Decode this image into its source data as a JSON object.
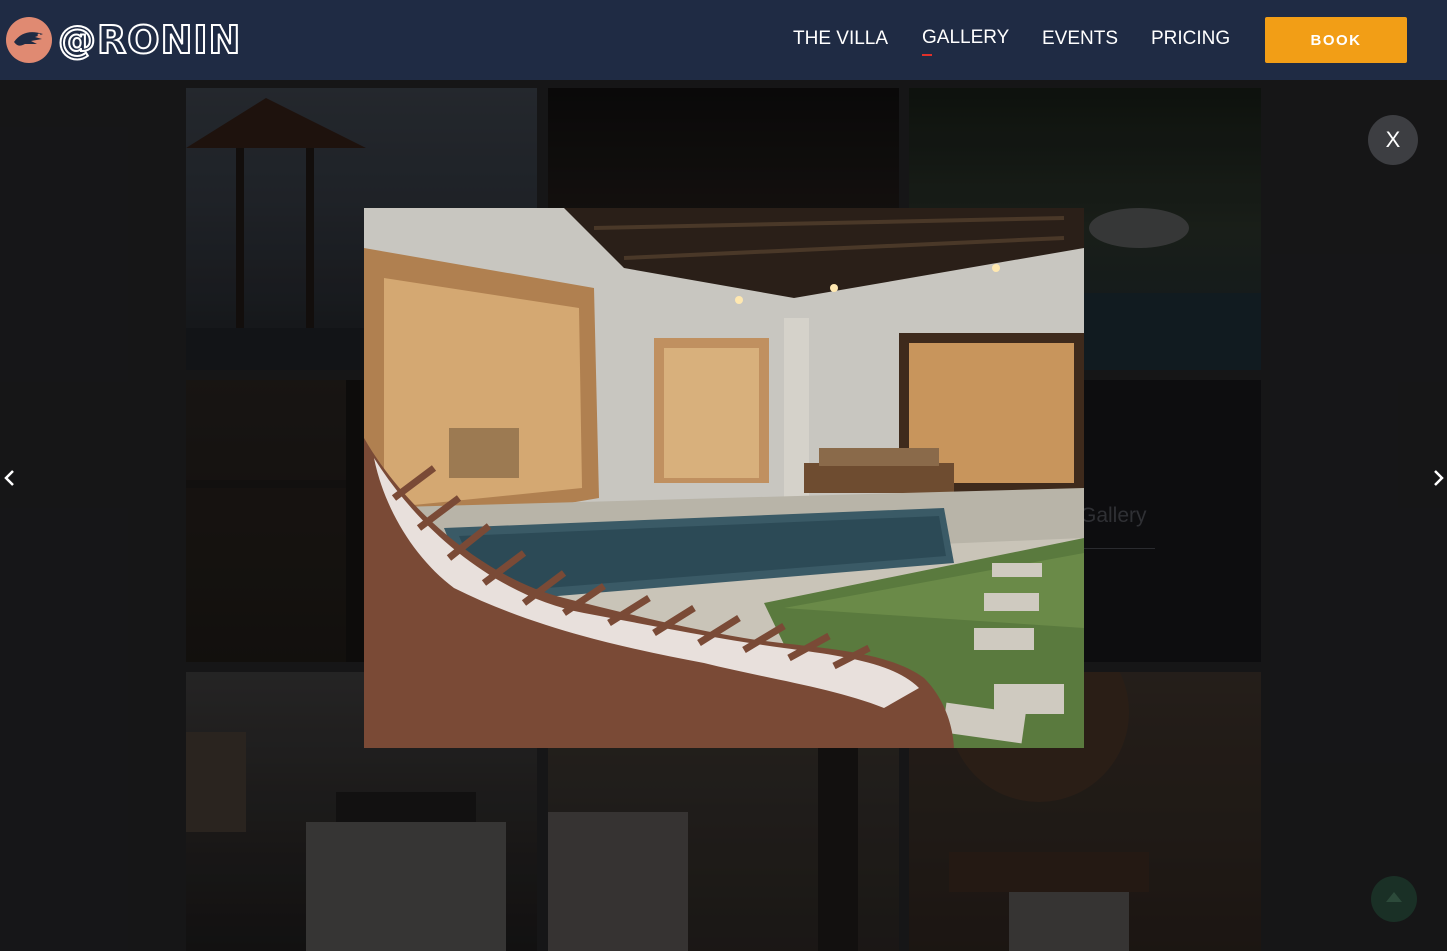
{
  "brand": {
    "name": "@RONIN"
  },
  "nav": {
    "items": [
      {
        "label": "THE VILLA"
      },
      {
        "label": "GALLERY",
        "active": true
      },
      {
        "label": "EVENTS"
      },
      {
        "label": "PRICING"
      }
    ],
    "book_label": "BOOK"
  },
  "gallery": {
    "overlay_label": "Gallery"
  },
  "lightbox": {
    "close_label": "X"
  },
  "colors": {
    "navbar": "#1f2b44",
    "book_button": "#f29e16",
    "active_underline": "#e0302a",
    "logo_accent": "#e08a72"
  },
  "icons": {
    "logo": "eagle-logo-icon",
    "prev": "chevron-left-icon",
    "next": "chevron-right-icon",
    "scroll_top": "caret-up-icon"
  }
}
